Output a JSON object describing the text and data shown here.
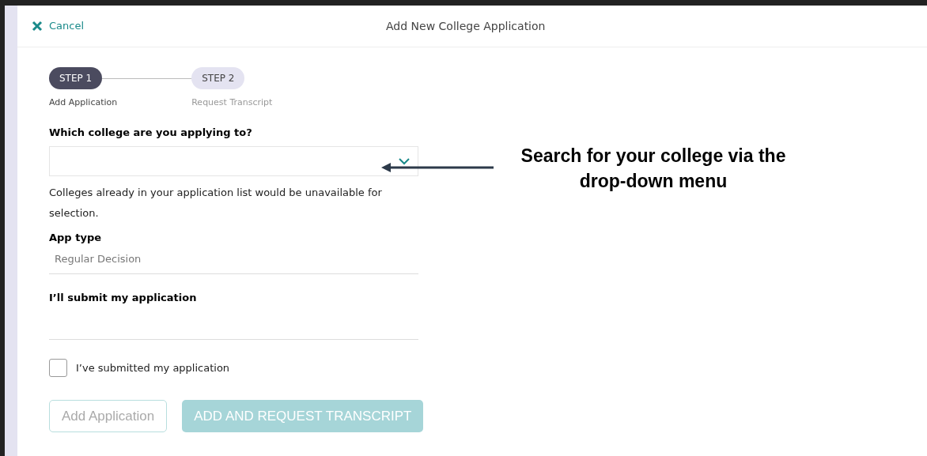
{
  "header": {
    "cancel": "Cancel",
    "title": "Add New College Application"
  },
  "steps": [
    {
      "label": "STEP 1",
      "caption": "Add Application",
      "selected": true
    },
    {
      "label": "STEP 2",
      "caption": "Request Transcript",
      "selected": false
    }
  ],
  "college": {
    "label": "Which college are you applying to?",
    "note": "Colleges already in your application list would be unavailable for selection."
  },
  "app_type": {
    "label": "App type",
    "value": "Regular Decision"
  },
  "submit": {
    "label": "I’ll submit my application"
  },
  "submitted": {
    "label": "I’ve submitted my application",
    "checked": false
  },
  "buttons": [
    {
      "label": "Add Application",
      "kind": "outline",
      "disabled": true
    },
    {
      "label": "ADD AND REQUEST TRANSCRIPT",
      "kind": "filled",
      "disabled": true
    }
  ],
  "annotation": {
    "text": "Search for your college via the drop-down menu"
  }
}
